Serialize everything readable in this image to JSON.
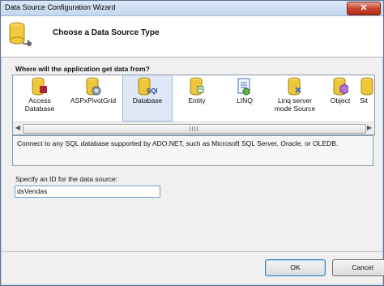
{
  "window": {
    "title": "Data Source Configuration Wizard",
    "close_label": "✕"
  },
  "header": {
    "title": "Choose a Data Source Type"
  },
  "section": {
    "label": "Where will the application get data from?"
  },
  "items": [
    {
      "label": "Access Database",
      "label2": ""
    },
    {
      "label": "ASPxPivotGrid",
      "label2": ""
    },
    {
      "label": "Database",
      "label2": ""
    },
    {
      "label": "Entity",
      "label2": ""
    },
    {
      "label": "LINQ",
      "label2": ""
    },
    {
      "label": "Linq server",
      "label2": "mode Source"
    },
    {
      "label": "Object",
      "label2": ""
    },
    {
      "label": "Sit",
      "label2": ""
    }
  ],
  "description": "Connect to any SQL database supported by ADO.NET, such as Microsoft SQL Server, Oracle, or OLEDB.",
  "id_field": {
    "label": "Specify an ID for the data source:",
    "value": "dsVendas"
  },
  "buttons": {
    "ok": "OK",
    "cancel": "Cancel"
  },
  "scrollbar": {
    "left": "◀",
    "right": "▶"
  }
}
